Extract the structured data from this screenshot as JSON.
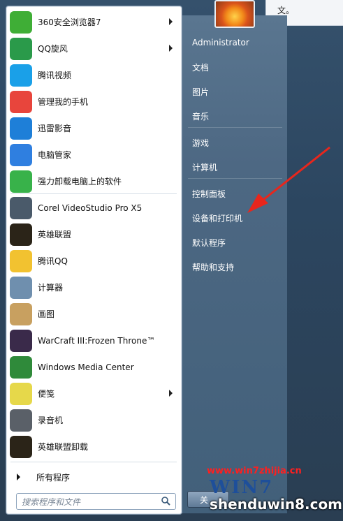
{
  "window_strip": {
    "text": "文。"
  },
  "user": {
    "name": "Administrator"
  },
  "programs": [
    {
      "label": "360安全浏览器7",
      "icon": "360-browser-icon",
      "color": "#3fae36",
      "arrow": true
    },
    {
      "label": "QQ旋风",
      "icon": "qq-whirlwind-icon",
      "color": "#2a9a4a",
      "arrow": true
    },
    {
      "label": "腾讯视频",
      "icon": "tencent-video-icon",
      "color": "#1aa0e8",
      "arrow": false
    },
    {
      "label": "管理我的手机",
      "icon": "phone-manager-icon",
      "color": "#e8453c",
      "arrow": false
    },
    {
      "label": "迅雷影音",
      "icon": "xunlei-player-icon",
      "color": "#1e7fd8",
      "arrow": false
    },
    {
      "label": "电脑管家",
      "icon": "pc-manager-icon",
      "color": "#2f7fe0",
      "arrow": false
    },
    {
      "label": "强力卸载电脑上的软件",
      "icon": "uninstall-icon",
      "color": "#38b24a",
      "arrow": false
    },
    {
      "label": "Corel VideoStudio Pro X5",
      "icon": "corel-videostudio-icon",
      "color": "#4a5a6a",
      "arrow": false
    },
    {
      "label": "英雄联盟",
      "icon": "lol-icon",
      "color": "#2b2418",
      "arrow": false
    },
    {
      "label": "腾讯QQ",
      "icon": "qq-penguin-icon",
      "color": "#f2c230",
      "arrow": false
    },
    {
      "label": "计算器",
      "icon": "calculator-icon",
      "color": "#6f8fae",
      "arrow": false
    },
    {
      "label": "画图",
      "icon": "paint-icon",
      "color": "#c8a060",
      "arrow": false
    },
    {
      "label": "WarCraft III:Frozen Throne™",
      "icon": "warcraft-icon",
      "color": "#3a2a4a",
      "arrow": false
    },
    {
      "label": "Windows Media Center",
      "icon": "windows-media-center-icon",
      "color": "#2f8a3a",
      "arrow": false
    },
    {
      "label": "便笺",
      "icon": "sticky-notes-icon",
      "color": "#e6d84a",
      "arrow": true
    },
    {
      "label": "录音机",
      "icon": "microphone-icon",
      "color": "#5a6068",
      "arrow": false
    },
    {
      "label": "英雄联盟卸载",
      "icon": "lol-uninstall-icon",
      "color": "#2b2418",
      "arrow": false
    }
  ],
  "all_programs": {
    "label": "所有程序"
  },
  "search": {
    "placeholder": "搜索程序和文件"
  },
  "right_menu": [
    {
      "label": "文档"
    },
    {
      "label": "图片"
    },
    {
      "label": "音乐"
    },
    {
      "label": "游戏"
    },
    {
      "label": "计算机"
    },
    {
      "label": "控制面板"
    },
    {
      "label": "设备和打印机"
    },
    {
      "label": "默认程序"
    },
    {
      "label": "帮助和支持"
    }
  ],
  "shutdown": {
    "label": "关"
  },
  "watermark": {
    "site1": "www.win7zhijia.cn",
    "brand": "WIN7",
    "site2": "shenduwin8.com"
  },
  "colors": {
    "arrow": "#e8261c",
    "right_panel": "#4d6883"
  }
}
